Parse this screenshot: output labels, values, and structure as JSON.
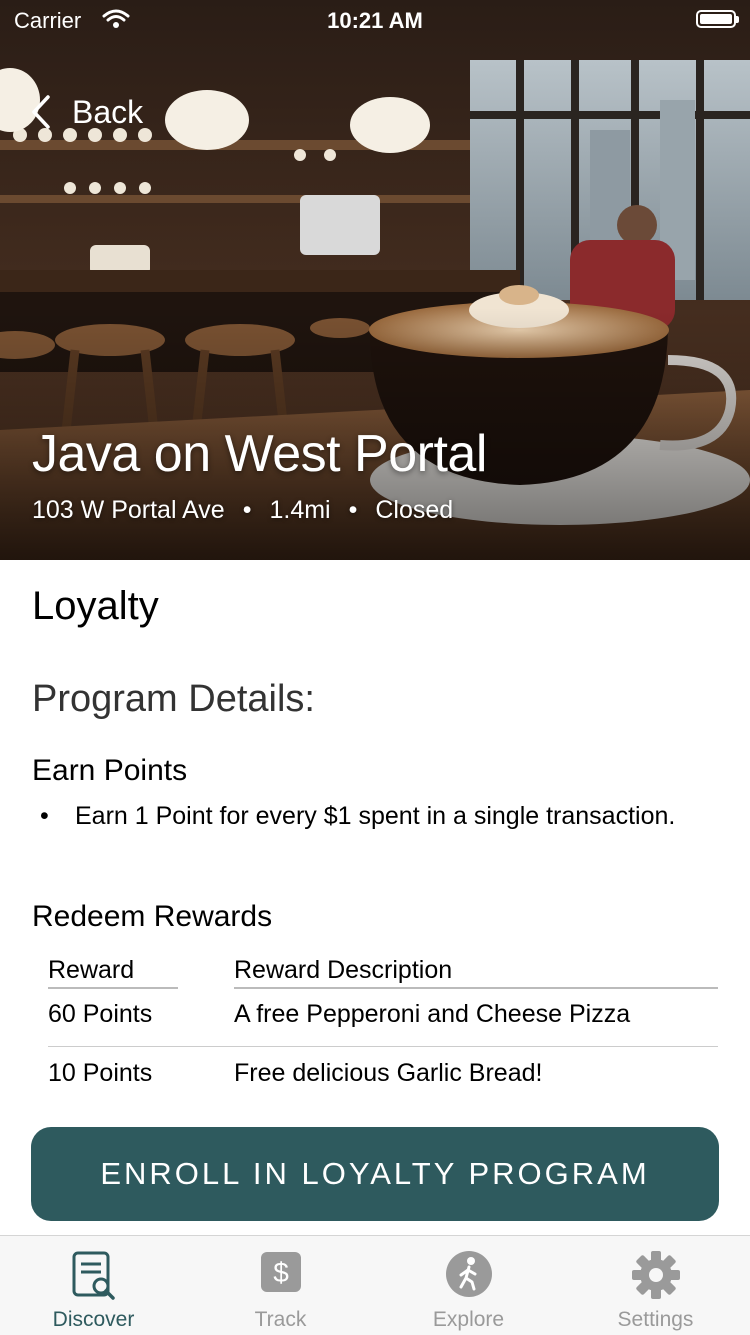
{
  "status_bar": {
    "carrier": "Carrier",
    "time": "10:21 AM"
  },
  "nav": {
    "back_label": "Back"
  },
  "shop": {
    "name": "Java on West Portal",
    "address": "103 W Portal Ave",
    "distance": "1.4mi",
    "status": "Closed"
  },
  "loyalty": {
    "title": "Loyalty",
    "program_title": "Program Details:",
    "earn_title": "Earn Points",
    "earn_items": [
      "Earn 1 Point for every $1 spent in a single transaction."
    ],
    "redeem_title": "Redeem Rewards",
    "columns": [
      "Reward",
      "Reward Description"
    ],
    "rewards": [
      {
        "reward": "60 Points",
        "description": "A free Pepperoni and Cheese Pizza"
      },
      {
        "reward": "10 Points",
        "description": "Free delicious Garlic Bread!"
      }
    ],
    "enroll_label": "ENROLL IN LOYALTY PROGRAM"
  },
  "tabs": [
    {
      "label": "Discover",
      "icon": "discover-icon",
      "active": true
    },
    {
      "label": "Track",
      "icon": "dollar-icon",
      "active": false
    },
    {
      "label": "Explore",
      "icon": "walking-icon",
      "active": false
    },
    {
      "label": "Settings",
      "icon": "gear-icon",
      "active": false
    }
  ],
  "colors": {
    "accent": "#2e5a5e",
    "inactive": "#9a9a9a"
  }
}
